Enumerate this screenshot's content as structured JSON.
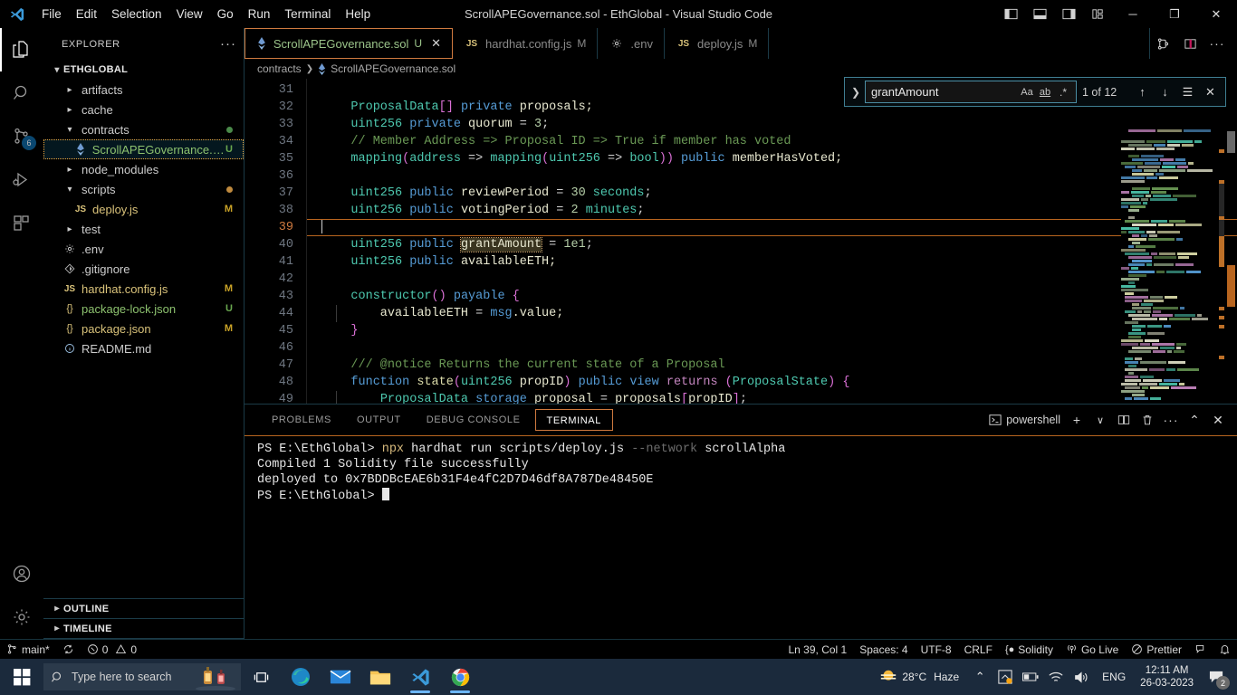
{
  "titlebar": {
    "title": "ScrollAPEGovernance.sol - EthGlobal - Visual Studio Code",
    "menus": [
      "File",
      "Edit",
      "Selection",
      "View",
      "Go",
      "Run",
      "Terminal",
      "Help"
    ],
    "layout_icons": [
      "toggle-primary-sidebar-icon",
      "toggle-panel-icon",
      "toggle-secondary-sidebar-icon",
      "customize-layout-icon"
    ],
    "window_buttons": {
      "minimize": "─",
      "maximize": "❐",
      "close": "✕"
    }
  },
  "activitybar": {
    "items": [
      {
        "name": "explorer",
        "icon": "files-icon",
        "active": true,
        "badge": ""
      },
      {
        "name": "search",
        "icon": "search-icon",
        "active": false,
        "badge": ""
      },
      {
        "name": "source-control",
        "icon": "source-control-icon",
        "active": false,
        "badge": "6"
      },
      {
        "name": "run-and-debug",
        "icon": "debug-icon",
        "active": false,
        "badge": ""
      },
      {
        "name": "extensions",
        "icon": "extensions-icon",
        "active": false,
        "badge": ""
      }
    ],
    "bottom": [
      {
        "name": "accounts",
        "icon": "account-icon"
      },
      {
        "name": "manage",
        "icon": "gear-icon"
      }
    ]
  },
  "sidebar": {
    "header": "EXPLORER",
    "more_actions": "···",
    "root": "ETHGLOBAL",
    "tree": [
      {
        "label": "artifacts",
        "type": "folder",
        "expanded": false,
        "indent": 1,
        "icon": "chevron-right-icon",
        "git": "",
        "dot": ""
      },
      {
        "label": "cache",
        "type": "folder",
        "expanded": false,
        "indent": 1,
        "icon": "chevron-right-icon",
        "git": "",
        "dot": ""
      },
      {
        "label": "contracts",
        "type": "folder",
        "expanded": true,
        "indent": 1,
        "icon": "chevron-down-icon",
        "git": "",
        "dot": "#4a8a4a"
      },
      {
        "label": "ScrollAPEGovernance.sol",
        "type": "file",
        "expanded": false,
        "indent": 2,
        "icon": "solidity-icon",
        "git": "U",
        "gitColor": "#6aa84f",
        "selected": true,
        "color": "#8dc26f"
      },
      {
        "label": "node_modules",
        "type": "folder",
        "expanded": false,
        "indent": 1,
        "icon": "chevron-right-icon",
        "git": "",
        "dot": ""
      },
      {
        "label": "scripts",
        "type": "folder",
        "expanded": true,
        "indent": 1,
        "icon": "chevron-down-icon",
        "git": "",
        "dot": "#c08a3e"
      },
      {
        "label": "deploy.js",
        "type": "file",
        "expanded": false,
        "indent": 2,
        "icon": "js-icon",
        "git": "M",
        "gitColor": "#c9a227",
        "color": "#d9c27a"
      },
      {
        "label": "test",
        "type": "folder",
        "expanded": false,
        "indent": 1,
        "icon": "chevron-right-icon",
        "git": "",
        "dot": ""
      },
      {
        "label": ".env",
        "type": "file",
        "expanded": false,
        "indent": 1,
        "icon": "gear-icon",
        "git": "",
        "color": "#cccccc"
      },
      {
        "label": ".gitignore",
        "type": "file",
        "expanded": false,
        "indent": 1,
        "icon": "gitignore-icon",
        "git": "",
        "color": "#cccccc"
      },
      {
        "label": "hardhat.config.js",
        "type": "file",
        "expanded": false,
        "indent": 1,
        "icon": "js-icon",
        "git": "M",
        "gitColor": "#c9a227",
        "color": "#d9c27a"
      },
      {
        "label": "package-lock.json",
        "type": "file",
        "expanded": false,
        "indent": 1,
        "icon": "json-icon",
        "git": "U",
        "gitColor": "#6aa84f",
        "color": "#8dc26f"
      },
      {
        "label": "package.json",
        "type": "file",
        "expanded": false,
        "indent": 1,
        "icon": "json-icon",
        "git": "M",
        "gitColor": "#c9a227",
        "color": "#d9c27a"
      },
      {
        "label": "README.md",
        "type": "file",
        "expanded": false,
        "indent": 1,
        "icon": "info-icon",
        "git": "",
        "color": "#cccccc"
      }
    ],
    "sections": [
      {
        "label": "OUTLINE",
        "expanded": false
      },
      {
        "label": "TIMELINE",
        "expanded": false
      }
    ]
  },
  "editor": {
    "tabs": [
      {
        "label": "ScrollAPEGovernance.sol",
        "icon": "solidity-icon",
        "status": "U",
        "active": true,
        "closable": true
      },
      {
        "label": "hardhat.config.js",
        "icon": "js-icon",
        "status": "M",
        "active": false,
        "closable": false
      },
      {
        "label": ".env",
        "icon": "gear-icon",
        "status": "",
        "active": false,
        "closable": false
      },
      {
        "label": "deploy.js",
        "icon": "js-icon",
        "status": "M",
        "active": false,
        "closable": false
      }
    ],
    "tab_actions": [
      "split-editor-right-icon",
      "split-editor-icon",
      "more-actions-icon"
    ],
    "breadcrumb": [
      "contracts",
      "ScrollAPEGovernance.sol"
    ],
    "breadcrumb_separator": "❯",
    "first_line_number": 31,
    "current_line": 39,
    "lines": [
      {
        "n": 31,
        "tokens": []
      },
      {
        "n": 32,
        "tokens": [
          {
            "t": "    ",
            "c": "op"
          },
          {
            "t": "ProposalData",
            "c": "ty"
          },
          {
            "t": "[]",
            "c": "br1"
          },
          {
            "t": " ",
            "c": "op"
          },
          {
            "t": "private",
            "c": "kw"
          },
          {
            "t": " proposals;",
            "c": "id"
          }
        ]
      },
      {
        "n": 33,
        "tokens": [
          {
            "t": "    ",
            "c": "op"
          },
          {
            "t": "uint256",
            "c": "ty"
          },
          {
            "t": " ",
            "c": "op"
          },
          {
            "t": "private",
            "c": "kw"
          },
          {
            "t": " quorum ",
            "c": "id"
          },
          {
            "t": "= ",
            "c": "op"
          },
          {
            "t": "3",
            "c": "num"
          },
          {
            "t": ";",
            "c": "op"
          }
        ]
      },
      {
        "n": 34,
        "tokens": [
          {
            "t": "    // Member Address => Proposal ID => True if member has voted",
            "c": "cm"
          }
        ]
      },
      {
        "n": 35,
        "tokens": [
          {
            "t": "    ",
            "c": "op"
          },
          {
            "t": "mapping",
            "c": "ty"
          },
          {
            "t": "(",
            "c": "br1"
          },
          {
            "t": "address",
            "c": "ty"
          },
          {
            "t": " => ",
            "c": "op"
          },
          {
            "t": "mapping",
            "c": "ty"
          },
          {
            "t": "(",
            "c": "br1"
          },
          {
            "t": "uint256",
            "c": "ty"
          },
          {
            "t": " => ",
            "c": "op"
          },
          {
            "t": "bool",
            "c": "ty"
          },
          {
            "t": "))",
            "c": "br1"
          },
          {
            "t": " ",
            "c": "op"
          },
          {
            "t": "public",
            "c": "kw"
          },
          {
            "t": " memberHasVoted;",
            "c": "id"
          }
        ]
      },
      {
        "n": 36,
        "tokens": []
      },
      {
        "n": 37,
        "tokens": [
          {
            "t": "    ",
            "c": "op"
          },
          {
            "t": "uint256",
            "c": "ty"
          },
          {
            "t": " ",
            "c": "op"
          },
          {
            "t": "public",
            "c": "kw"
          },
          {
            "t": " reviewPeriod ",
            "c": "id"
          },
          {
            "t": "= ",
            "c": "op"
          },
          {
            "t": "30",
            "c": "num"
          },
          {
            "t": " ",
            "c": "op"
          },
          {
            "t": "seconds",
            "c": "ty"
          },
          {
            "t": ";",
            "c": "op"
          }
        ]
      },
      {
        "n": 38,
        "tokens": [
          {
            "t": "    ",
            "c": "op"
          },
          {
            "t": "uint256",
            "c": "ty"
          },
          {
            "t": " ",
            "c": "op"
          },
          {
            "t": "public",
            "c": "kw"
          },
          {
            "t": " votingPeriod ",
            "c": "id"
          },
          {
            "t": "= ",
            "c": "op"
          },
          {
            "t": "2",
            "c": "num"
          },
          {
            "t": " ",
            "c": "op"
          },
          {
            "t": "minutes",
            "c": "ty"
          },
          {
            "t": ";",
            "c": "op"
          }
        ]
      },
      {
        "n": 39,
        "tokens": [],
        "current": true
      },
      {
        "n": 40,
        "tokens": [
          {
            "t": "    ",
            "c": "op"
          },
          {
            "t": "uint256",
            "c": "ty"
          },
          {
            "t": " ",
            "c": "op"
          },
          {
            "t": "public",
            "c": "kw"
          },
          {
            "t": " ",
            "c": "id"
          },
          {
            "t": "grantAmount",
            "c": "id",
            "match": true
          },
          {
            "t": " = ",
            "c": "op"
          },
          {
            "t": "1e1",
            "c": "num"
          },
          {
            "t": ";",
            "c": "op"
          }
        ]
      },
      {
        "n": 41,
        "tokens": [
          {
            "t": "    ",
            "c": "op"
          },
          {
            "t": "uint256",
            "c": "ty"
          },
          {
            "t": " ",
            "c": "op"
          },
          {
            "t": "public",
            "c": "kw"
          },
          {
            "t": " availableETH;",
            "c": "id"
          }
        ]
      },
      {
        "n": 42,
        "tokens": []
      },
      {
        "n": 43,
        "tokens": [
          {
            "t": "    ",
            "c": "op"
          },
          {
            "t": "constructor",
            "c": "ty"
          },
          {
            "t": "()",
            "c": "br1"
          },
          {
            "t": " ",
            "c": "op"
          },
          {
            "t": "payable",
            "c": "kw"
          },
          {
            "t": " ",
            "c": "op"
          },
          {
            "t": "{",
            "c": "br1"
          }
        ]
      },
      {
        "n": 44,
        "tokens": [
          {
            "t": "        availableETH ",
            "c": "id"
          },
          {
            "t": "= ",
            "c": "op"
          },
          {
            "t": "msg",
            "c": "kw"
          },
          {
            "t": ".value;",
            "c": "id"
          }
        ],
        "indentGuide": true
      },
      {
        "n": 45,
        "tokens": [
          {
            "t": "    ",
            "c": "op"
          },
          {
            "t": "}",
            "c": "br1"
          }
        ]
      },
      {
        "n": 46,
        "tokens": []
      },
      {
        "n": 47,
        "tokens": [
          {
            "t": "    /// @notice Returns the current state of a Proposal",
            "c": "cm"
          }
        ]
      },
      {
        "n": 48,
        "tokens": [
          {
            "t": "    ",
            "c": "op"
          },
          {
            "t": "function",
            "c": "kw"
          },
          {
            "t": " ",
            "c": "op"
          },
          {
            "t": "state",
            "c": "fn"
          },
          {
            "t": "(",
            "c": "br1"
          },
          {
            "t": "uint256",
            "c": "ty"
          },
          {
            "t": " propID",
            "c": "id"
          },
          {
            "t": ")",
            "c": "br1"
          },
          {
            "t": " ",
            "c": "op"
          },
          {
            "t": "public",
            "c": "kw"
          },
          {
            "t": " ",
            "c": "op"
          },
          {
            "t": "view",
            "c": "kw"
          },
          {
            "t": " ",
            "c": "op"
          },
          {
            "t": "returns",
            "c": "pn"
          },
          {
            "t": " ",
            "c": "op"
          },
          {
            "t": "(",
            "c": "br1"
          },
          {
            "t": "ProposalState",
            "c": "ty"
          },
          {
            "t": ")",
            "c": "br1"
          },
          {
            "t": " ",
            "c": "op"
          },
          {
            "t": "{",
            "c": "br1"
          }
        ]
      },
      {
        "n": 49,
        "tokens": [
          {
            "t": "        ",
            "c": "op"
          },
          {
            "t": "ProposalData",
            "c": "ty"
          },
          {
            "t": " ",
            "c": "op"
          },
          {
            "t": "storage",
            "c": "kw"
          },
          {
            "t": " proposal ",
            "c": "id"
          },
          {
            "t": "= ",
            "c": "op"
          },
          {
            "t": "proposals",
            "c": "id"
          },
          {
            "t": "[",
            "c": "br1"
          },
          {
            "t": "propID",
            "c": "id"
          },
          {
            "t": "]",
            "c": "br1"
          },
          {
            "t": ";",
            "c": "op"
          }
        ],
        "indentGuide": true
      }
    ]
  },
  "find": {
    "expand_icon": "chevron-right-icon",
    "query": "grantAmount",
    "placeholder": "Find",
    "options": [
      {
        "name": "match-case-icon",
        "label": "Aa"
      },
      {
        "name": "match-whole-word-icon",
        "label": "ab"
      },
      {
        "name": "use-regex-icon",
        "label": ".*"
      }
    ],
    "result_count": "1 of 12",
    "buttons": [
      {
        "name": "previous-match-icon",
        "glyph": "↑"
      },
      {
        "name": "next-match-icon",
        "glyph": "↓"
      },
      {
        "name": "find-in-selection-icon",
        "glyph": "☰"
      },
      {
        "name": "close-find-icon",
        "glyph": "✕"
      }
    ]
  },
  "panel": {
    "tabs": [
      {
        "label": "PROBLEMS",
        "active": false
      },
      {
        "label": "OUTPUT",
        "active": false
      },
      {
        "label": "DEBUG CONSOLE",
        "active": false
      },
      {
        "label": "TERMINAL",
        "active": true
      }
    ],
    "shell_name": "powershell",
    "shell_icon": "terminal-icon",
    "actions": [
      {
        "name": "new-terminal-icon",
        "glyph": "+"
      },
      {
        "name": "terminal-dropdown-icon",
        "glyph": "∨"
      },
      {
        "name": "split-terminal-icon",
        "glyph": "◫"
      },
      {
        "name": "kill-terminal-icon",
        "glyph": "🗑"
      },
      {
        "name": "panel-more-actions-icon",
        "glyph": "···"
      },
      {
        "name": "maximize-panel-icon",
        "glyph": "⌃"
      },
      {
        "name": "close-panel-icon",
        "glyph": "✕"
      }
    ],
    "terminal_lines": [
      [
        {
          "t": "PS E:\\EthGlobal> ",
          "c": ""
        },
        {
          "t": "npx",
          "c": "t-yellow"
        },
        {
          "t": " hardhat run scripts/deploy.js ",
          "c": ""
        },
        {
          "t": "--network",
          "c": "t-gray"
        },
        {
          "t": " scrollAlpha",
          "c": ""
        }
      ],
      [
        {
          "t": "Compiled 1 Solidity file successfully",
          "c": ""
        }
      ],
      [
        {
          "t": "deployed to 0x7BDDBcEAE6b31F4e4fC2D7D46df8A787De48450E",
          "c": ""
        }
      ],
      [
        {
          "t": "PS E:\\EthGlobal> ",
          "c": ""
        },
        {
          "t": "",
          "c": "cursor"
        }
      ]
    ]
  },
  "statusbar": {
    "left": [
      {
        "name": "remote-branch",
        "icon": "source-control-icon",
        "text": "main*"
      },
      {
        "name": "sync-changes",
        "icon": "sync-icon",
        "text": ""
      },
      {
        "name": "problems",
        "icon": "error-warning-icon",
        "text": "0  0"
      }
    ],
    "branch": "main*",
    "errors": "0",
    "warnings": "0",
    "right": [
      {
        "name": "editor-position",
        "text": "Ln 39, Col 1"
      },
      {
        "name": "editor-indentation",
        "text": "Spaces: 4"
      },
      {
        "name": "editor-encoding",
        "text": "UTF-8"
      },
      {
        "name": "editor-eol",
        "text": "CRLF"
      },
      {
        "name": "editor-language",
        "text": "Solidity",
        "icon": "solidity-icon"
      },
      {
        "name": "go-live",
        "text": "Go Live",
        "icon": "broadcast-icon"
      },
      {
        "name": "prettier",
        "text": "Prettier",
        "icon": "prettier-icon"
      },
      {
        "name": "feedback",
        "text": "",
        "icon": "feedback-icon"
      },
      {
        "name": "notifications",
        "text": "",
        "icon": "bell-icon"
      }
    ]
  },
  "taskbar": {
    "start": "windows-start-icon",
    "search_placeholder": "Type here to search",
    "search_icon": "search-icon",
    "items": [
      {
        "name": "task-view",
        "icon": "task-view-icon",
        "running": false
      },
      {
        "name": "microsoft-edge",
        "icon": "edge-icon",
        "running": false
      },
      {
        "name": "mail",
        "icon": "mail-icon",
        "running": false
      },
      {
        "name": "file-explorer",
        "icon": "folder-icon",
        "running": false
      },
      {
        "name": "visual-studio-code",
        "icon": "vscode-icon",
        "running": true
      },
      {
        "name": "google-chrome",
        "icon": "chrome-icon",
        "running": true
      }
    ],
    "tray": {
      "weather_temp": "28°C",
      "weather_desc": "Haze",
      "weather_icon": "haze-icon",
      "chevron": "⌃",
      "icons": [
        "onedrive-icon",
        "battery-icon",
        "wifi-icon",
        "volume-icon"
      ],
      "language": "ENG",
      "time": "12:11 AM",
      "date": "26-03-2023",
      "notification_count": "2"
    }
  },
  "colors": {
    "accent_orange": "#cf7a3f",
    "accent_blue": "#3f7e92",
    "background": "#000000",
    "taskbar": "#1b2a3c",
    "green_text": "#8dc26f",
    "yellow_text": "#d9c27a"
  }
}
